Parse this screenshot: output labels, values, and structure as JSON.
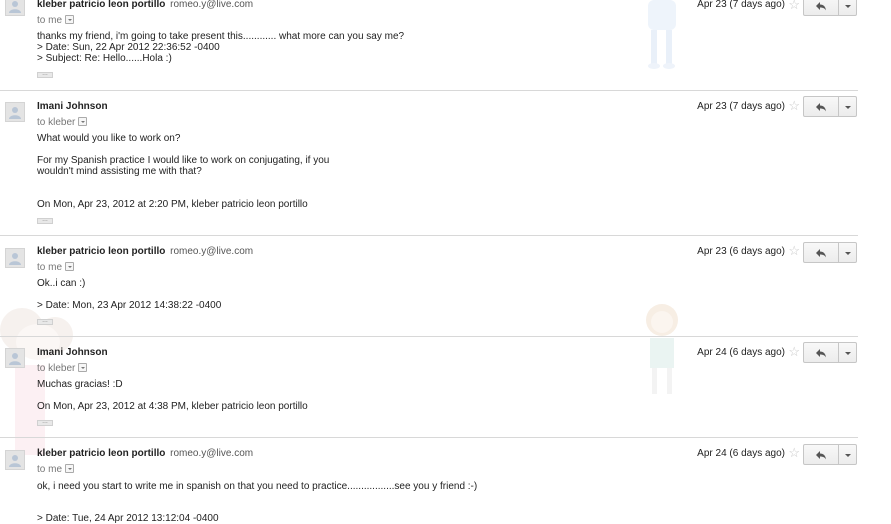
{
  "messages": [
    {
      "sender_name": "kleber patricio leon portillo",
      "sender_email": "romeo.y@live.com",
      "to": "to me",
      "date": "Apr 23 (7 days ago)",
      "lines": [
        "thanks my friend, i'm going to take present this............ what more can you say me?",
        "> Date: Sun, 22 Apr 2012 22:36:52 -0400",
        "> Subject: Re: Hello......Hola :)"
      ]
    },
    {
      "sender_name": "Imani Johnson",
      "sender_email": "",
      "to": "to kleber",
      "date": "Apr 23 (7 days ago)",
      "lines": [
        "What would you like to work on?",
        "For my Spanish practice I would like to work on conjugating, if you",
        "wouldn't mind assisting me with that?",
        "On Mon, Apr 23, 2012 at 2:20 PM, kleber patricio leon portillo"
      ]
    },
    {
      "sender_name": "kleber patricio leon portillo",
      "sender_email": "romeo.y@live.com",
      "to": "to me",
      "date": "Apr 23 (6 days ago)",
      "lines": [
        "Ok..i can :)",
        "> Date: Mon, 23 Apr 2012 14:38:22 -0400"
      ]
    },
    {
      "sender_name": "Imani Johnson",
      "sender_email": "",
      "to": "to kleber",
      "date": "Apr 24 (6 days ago)",
      "lines": [
        "Muchas gracias! :D",
        "On Mon, Apr 23, 2012 at 4:38 PM, kleber patricio leon portillo"
      ]
    },
    {
      "sender_name": "kleber patricio leon portillo",
      "sender_email": "romeo.y@live.com",
      "to": "to me",
      "date": "Apr 24 (6 days ago)",
      "lines": [
        "ok, i need you start to write me in spanish on that you need to practice.................see you y friend :-)",
        "> Date: Tue, 24 Apr 2012 13:12:04 -0400"
      ]
    }
  ],
  "ellipsis_label": "…",
  "icons": {
    "avatar": "person-icon",
    "star": "star-icon",
    "reply": "reply-arrow-icon",
    "more": "chevron-down-icon",
    "to_details": "details-caret-icon"
  },
  "colors": {
    "border": "#d8d8d8",
    "star": "#c8c8c8",
    "button_border": "#c6c6c6",
    "avatar_bg": "#e4e4e4"
  }
}
